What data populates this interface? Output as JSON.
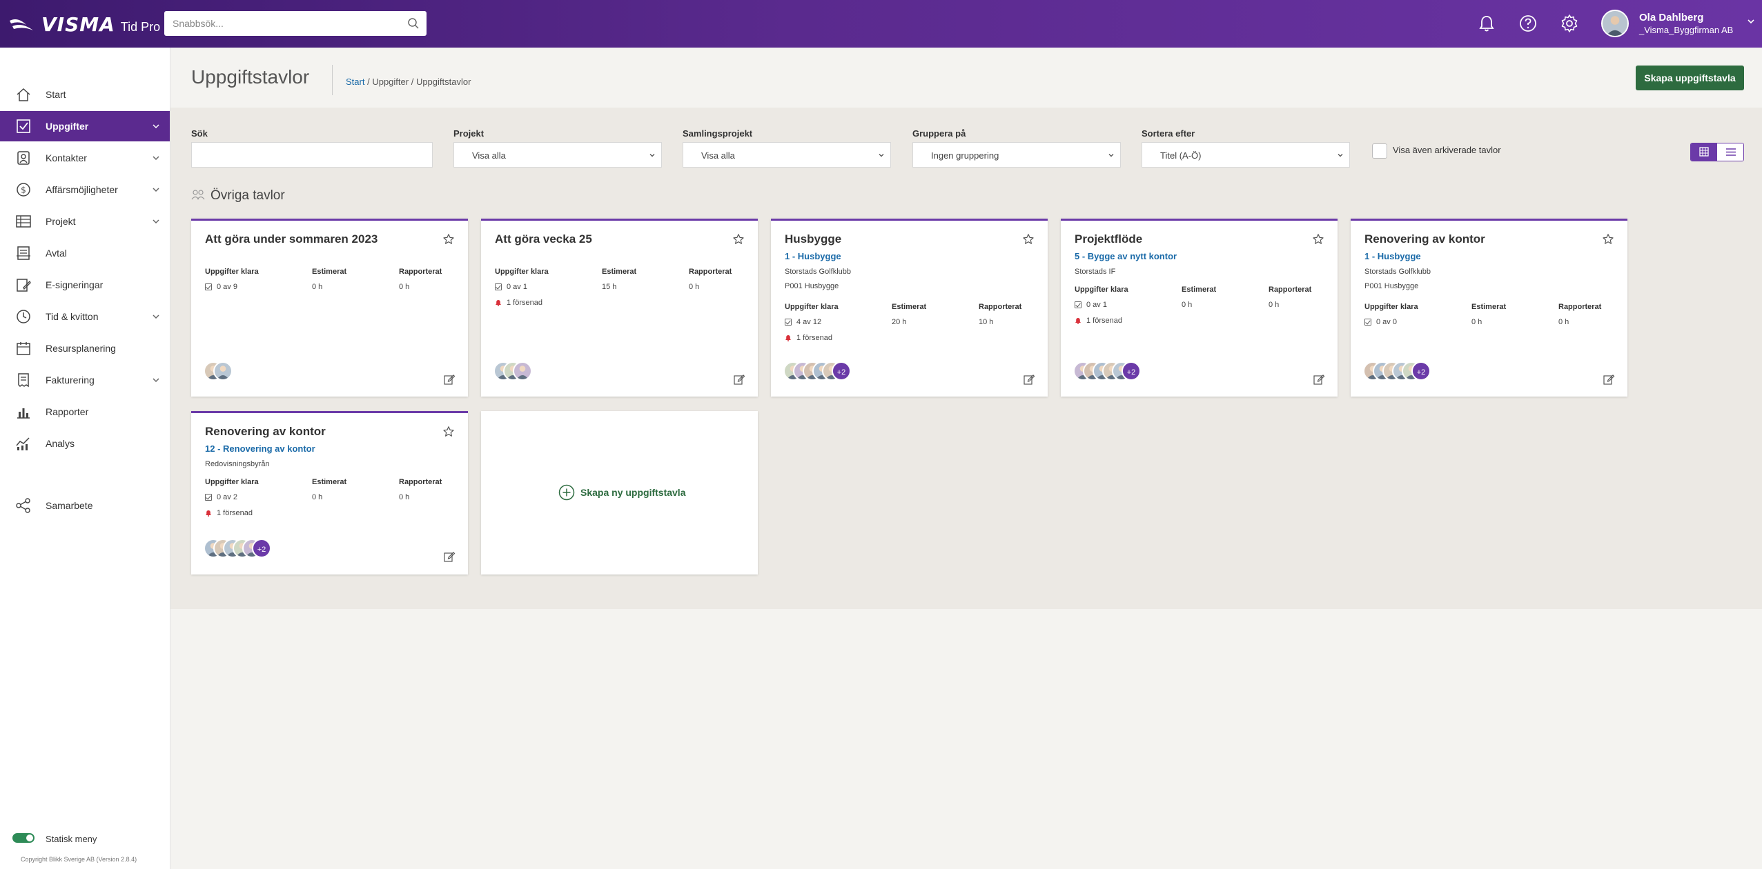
{
  "app": {
    "brand": "VISMA",
    "product": "Tid Pro"
  },
  "topbar": {
    "search_placeholder": "Snabbsök...",
    "user_name": "Ola Dahlberg",
    "user_company": "_Visma_Byggfirman AB"
  },
  "sidebar": {
    "items": [
      {
        "label": "Start",
        "icon": "home-icon",
        "chevron": false,
        "active": false
      },
      {
        "label": "Uppgifter",
        "icon": "checkbox-icon",
        "chevron": true,
        "active": true
      },
      {
        "label": "Kontakter",
        "icon": "contacts-icon",
        "chevron": true,
        "active": false
      },
      {
        "label": "Affärsmöjligheter",
        "icon": "dollar-icon",
        "chevron": true,
        "active": false
      },
      {
        "label": "Projekt",
        "icon": "table-icon",
        "chevron": true,
        "active": false
      },
      {
        "label": "Avtal",
        "icon": "contract-icon",
        "chevron": false,
        "active": false
      },
      {
        "label": "E-signeringar",
        "icon": "signature-icon",
        "chevron": false,
        "active": false
      },
      {
        "label": "Tid & kvitton",
        "icon": "clock-icon",
        "chevron": true,
        "active": false
      },
      {
        "label": "Resursplanering",
        "icon": "calendar-icon",
        "chevron": false,
        "active": false
      },
      {
        "label": "Fakturering",
        "icon": "invoice-icon",
        "chevron": true,
        "active": false
      },
      {
        "label": "Rapporter",
        "icon": "bar-chart-icon",
        "chevron": false,
        "active": false
      },
      {
        "label": "Analys",
        "icon": "analytics-icon",
        "chevron": false,
        "active": false
      },
      {
        "label": "Samarbete",
        "icon": "share-icon",
        "chevron": false,
        "active": false
      }
    ],
    "static_menu_label": "Statisk meny",
    "static_menu_on": true,
    "copyright": "Copyright Blikk Sverige AB (Version 2.8.4)"
  },
  "header": {
    "title": "Uppgiftstavlor",
    "breadcrumb": [
      "Start",
      "Uppgifter",
      "Uppgiftstavlor"
    ],
    "create_button": "Skapa uppgiftstavla"
  },
  "filters": {
    "search_label": "Sök",
    "search_value": "",
    "project_label": "Projekt",
    "project_value": "Visa alla",
    "collection_label": "Samlingsprojekt",
    "collection_value": "Visa alla",
    "group_label": "Gruppera på",
    "group_value": "Ingen gruppering",
    "sort_label": "Sortera efter",
    "sort_value": "Titel (A-Ö)",
    "archive_label": "Visa även arkiverade tavlor",
    "archive_checked": false,
    "view_mode": "grid"
  },
  "section": {
    "title": "Övriga tavlor"
  },
  "stat_labels": {
    "done": "Uppgifter klara",
    "estimated": "Estimerat",
    "reported": "Rapporterat"
  },
  "boards": [
    {
      "title": "Att göra under sommaren 2023",
      "project": "",
      "customer": "",
      "project_code": "",
      "done": "0 av 9",
      "estimated": "0 h",
      "reported": "0 h",
      "late": "",
      "avatars": 2,
      "more": ""
    },
    {
      "title": "Att göra vecka 25",
      "project": "",
      "customer": "",
      "project_code": "",
      "done": "0 av 1",
      "estimated": "15 h",
      "reported": "0 h",
      "late": "1 försenad",
      "avatars": 3,
      "more": ""
    },
    {
      "title": "Husbygge",
      "project": "1 - Husbygge",
      "customer": "Storstads Golfklubb",
      "project_code": "P001 Husbygge",
      "done": "4 av 12",
      "estimated": "20 h",
      "reported": "10 h",
      "late": "1 försenad",
      "avatars": 5,
      "more": "+2"
    },
    {
      "title": "Projektflöde",
      "project": "5 - Bygge av nytt kontor",
      "customer": "Storstads IF",
      "project_code": "",
      "done": "0 av 1",
      "estimated": "0 h",
      "reported": "0 h",
      "late": "1 försenad",
      "avatars": 5,
      "more": "+2"
    },
    {
      "title": "Renovering av kontor",
      "project": "1 - Husbygge",
      "customer": "Storstads Golfklubb",
      "project_code": "P001 Husbygge",
      "done": "0 av 0",
      "estimated": "0 h",
      "reported": "0 h",
      "late": "",
      "avatars": 5,
      "more": "+2"
    },
    {
      "title": "Renovering av kontor",
      "project": "12 - Renovering av kontor",
      "customer": "Redovisningsbyrån",
      "project_code": "",
      "done": "0 av 2",
      "estimated": "0 h",
      "reported": "0 h",
      "late": "1 försenad",
      "avatars": 5,
      "more": "+2"
    }
  ],
  "new_board": {
    "label": "Skapa ny uppgiftstavla"
  },
  "colors": {
    "brand_purple": "#5b2a8f",
    "accent_green": "#2d6b3f",
    "link_blue": "#1a6aa8",
    "late_red": "#d9303a"
  }
}
